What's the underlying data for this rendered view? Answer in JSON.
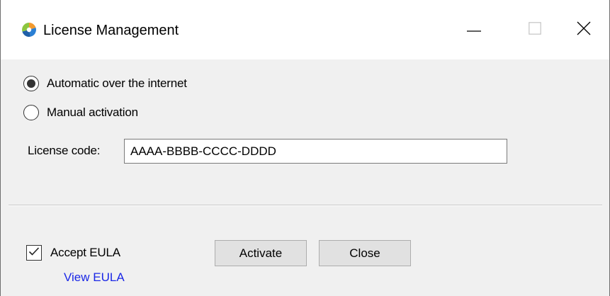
{
  "window": {
    "title": "License Management",
    "icon": "app-logo-icon",
    "controls": {
      "minimize": "minimize-icon",
      "maximize": "maximize-icon",
      "close": "close-icon"
    }
  },
  "activation": {
    "options": [
      {
        "label": "Automatic over the internet",
        "selected": true
      },
      {
        "label": "Manual activation",
        "selected": false
      }
    ]
  },
  "license": {
    "label": "License code:",
    "value": "AAAA-BBBB-CCCC-DDDD"
  },
  "footer": {
    "accept_eula_label": "Accept EULA",
    "accept_eula_checked": true,
    "view_eula_label": "View EULA",
    "activate_label": "Activate",
    "close_label": "Close"
  },
  "colors": {
    "link": "#1a27e6",
    "window_bg": "#f0f0f0",
    "titlebar_bg": "#ffffff",
    "button_bg": "#e1e1e1"
  }
}
